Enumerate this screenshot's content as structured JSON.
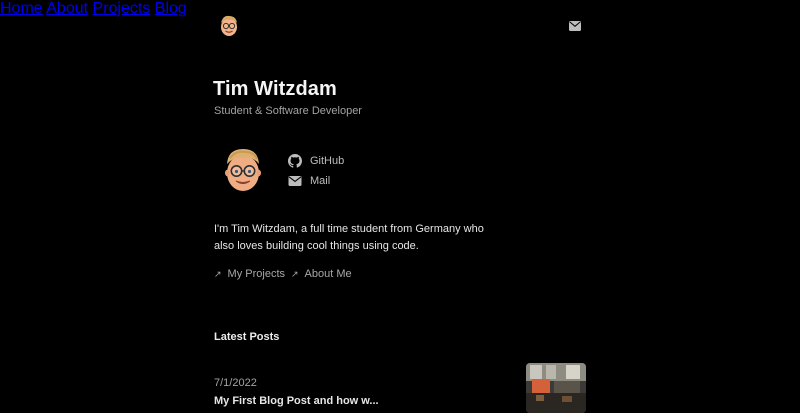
{
  "nav": {
    "links": [
      {
        "label": "Home"
      },
      {
        "label": "About"
      },
      {
        "label": "Projects"
      },
      {
        "label": "Blog"
      }
    ]
  },
  "hero": {
    "name": "Tim Witzdam",
    "subtitle": "Student & Software Developer"
  },
  "social": {
    "github": "GitHub",
    "mail": "Mail"
  },
  "bio": "I'm Tim Witzdam, a full time student from Germany who also loves building cool things using code.",
  "cta": {
    "projects": "My Projects",
    "about": "About Me"
  },
  "posts_section": {
    "title": "Latest Posts",
    "posts": [
      {
        "date": "7/1/2022",
        "title": "My First Blog Post and how w..."
      }
    ]
  },
  "icons": {
    "nav_avatar": "memoji-avatar-icon",
    "nav_mail": "mail-icon",
    "github": "github-icon",
    "mail": "mail-icon",
    "arrow": "arrow-up-right-icon"
  }
}
